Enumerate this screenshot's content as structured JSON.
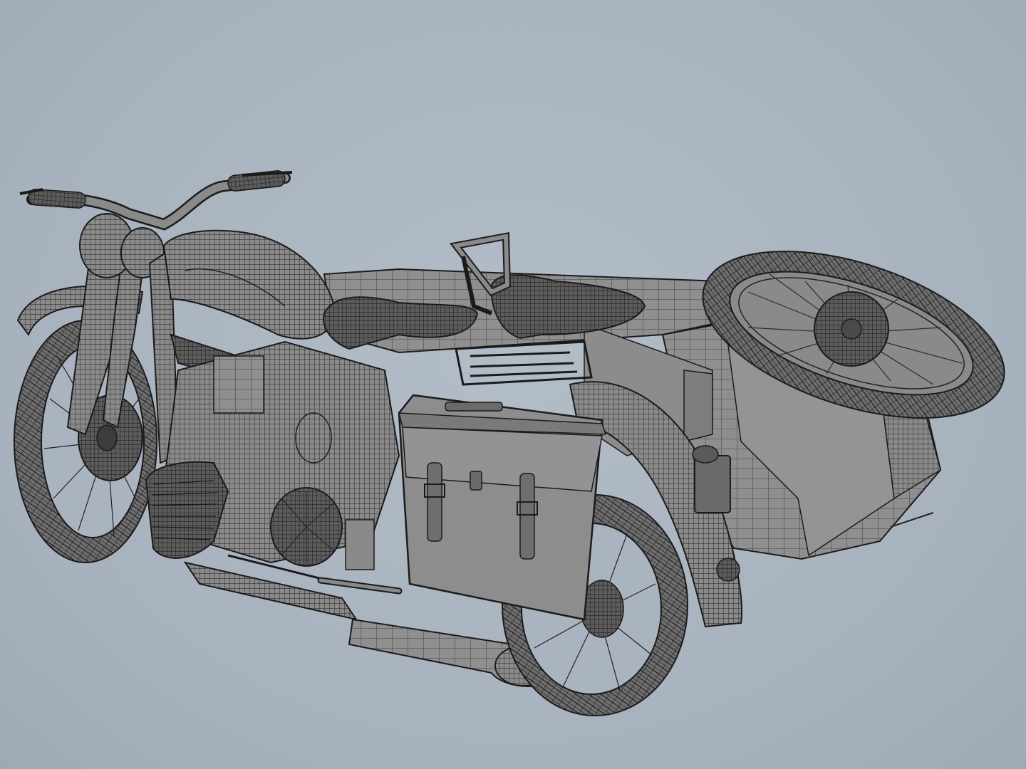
{
  "scene": {
    "subject": "wireframe-render",
    "colors": {
      "background": "#a9b4c0",
      "surface": "#8e8e8e",
      "surface_dark": "#5f5f5f",
      "surface_light": "#b5b5b5",
      "wire": "#1b1b1b"
    }
  }
}
